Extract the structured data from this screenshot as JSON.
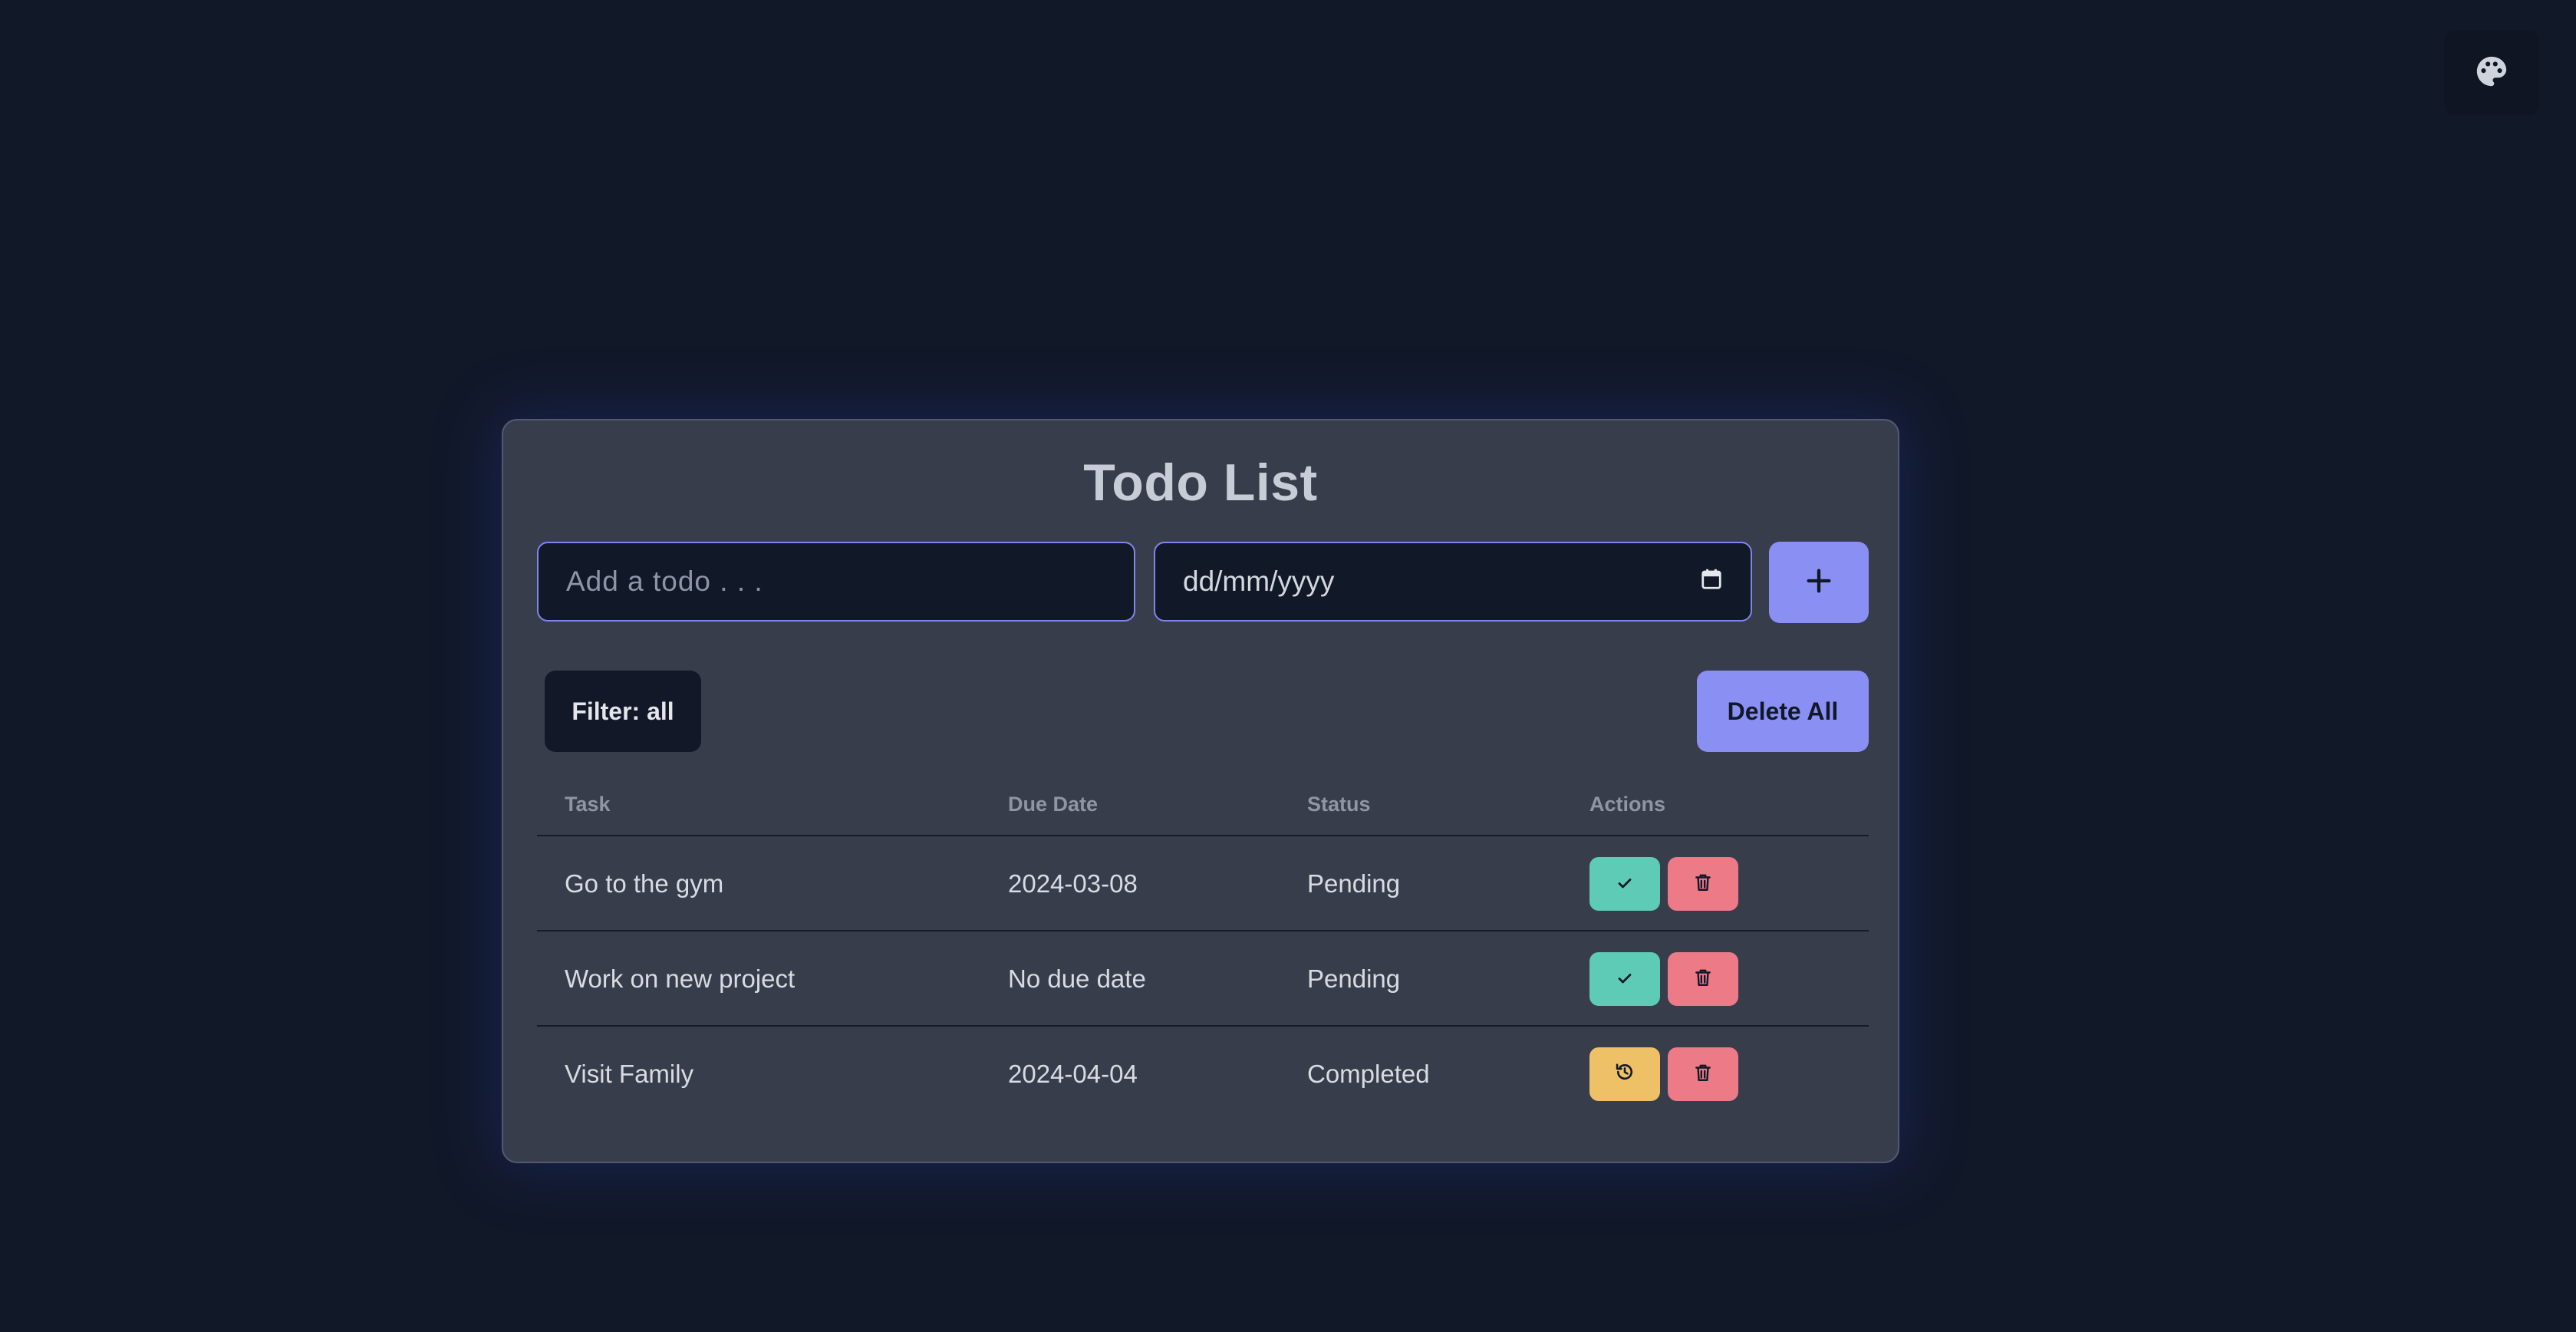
{
  "theme_toggle": {
    "icon": "palette-icon"
  },
  "card": {
    "title": "Todo List",
    "todo_input": {
      "placeholder": "Add a todo . . ."
    },
    "date_input": {
      "placeholder": "dd/mm/yyyy",
      "icon": "calendar-icon"
    },
    "add_button": {
      "icon": "plus-icon"
    },
    "filter_button": {
      "label": "Filter: all"
    },
    "delete_all_button": {
      "label": "Delete All"
    },
    "table": {
      "headers": {
        "task": "Task",
        "due": "Due Date",
        "status": "Status",
        "actions": "Actions"
      },
      "rows": [
        {
          "task": "Go to the gym",
          "due": "2024-03-08",
          "status": "Pending",
          "primary_action": "check-icon"
        },
        {
          "task": "Work on new project",
          "due": "No due date",
          "status": "Pending",
          "primary_action": "check-icon"
        },
        {
          "task": "Visit Family",
          "due": "2024-04-04",
          "status": "Completed",
          "primary_action": "undo-history-icon"
        }
      ]
    }
  },
  "colors": {
    "background": "#111828",
    "card": "#383d4c",
    "accent": "#8a8ff4",
    "complete_button": "#5dcbb5",
    "undo_button": "#eec166",
    "delete_button": "#ed7a87"
  }
}
